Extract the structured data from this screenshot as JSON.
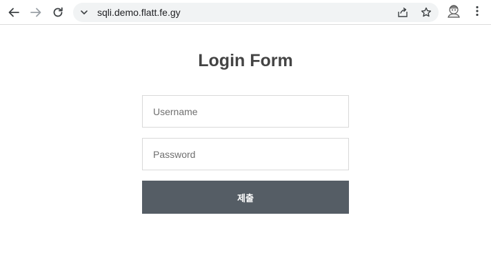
{
  "browser": {
    "url": "sqli.demo.flatt.fe.gy",
    "icons": {
      "back": "arrow-left-icon",
      "forward": "arrow-right-icon",
      "reload": "reload-icon",
      "site_info": "chevron-down-icon",
      "share": "share-icon",
      "bookmark": "star-icon",
      "profile": "profile-avatar-icon",
      "menu": "kebab-menu-icon"
    }
  },
  "login": {
    "title": "Login Form",
    "username_placeholder": "Username",
    "username_value": "",
    "password_placeholder": "Password",
    "password_value": "",
    "submit_label": "제출"
  },
  "colors": {
    "button_bg": "#555d65",
    "title_color": "#444444",
    "field_border": "#d9d9d9"
  }
}
